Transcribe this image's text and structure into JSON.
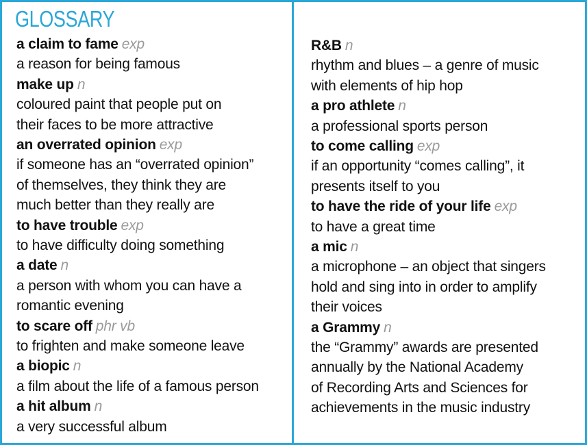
{
  "title": "GLOSSARY",
  "left_entries": [
    {
      "term": "a claim to fame",
      "pos": "exp",
      "definition": [
        "a reason for being famous"
      ]
    },
    {
      "term": "make up",
      "pos": "n",
      "definition": [
        "coloured paint that people put on",
        "their faces to be more attractive"
      ]
    },
    {
      "term": "an overrated opinion",
      "pos": "exp",
      "definition": [
        "if someone has an “overrated opinion”",
        "of themselves, they think they are",
        "much better than they really are"
      ]
    },
    {
      "term": "to have trouble",
      "pos": "exp",
      "definition": [
        "to have difficulty doing something"
      ]
    },
    {
      "term": "a date",
      "pos": "n",
      "definition": [
        "a person with whom you can have a",
        "romantic evening"
      ]
    },
    {
      "term": "to scare off",
      "pos": "phr vb",
      "definition": [
        "to frighten and make someone leave"
      ]
    },
    {
      "term": "a biopic",
      "pos": "n",
      "definition": [
        "a film about the life of a famous person"
      ]
    },
    {
      "term": "a hit album",
      "pos": "n",
      "definition": [
        "a very successful album"
      ]
    }
  ],
  "right_entries": [
    {
      "term": "R&B",
      "pos": "n",
      "definition": [
        "rhythm and blues – a genre of music",
        "with elements of hip hop"
      ]
    },
    {
      "term": "a pro athlete",
      "pos": "n",
      "definition": [
        "a professional sports person"
      ]
    },
    {
      "term": "to come calling",
      "pos": "exp",
      "definition": [
        "if an opportunity “comes calling”, it",
        "presents itself to you"
      ]
    },
    {
      "term": "to have the ride of your life",
      "pos": "exp",
      "definition": [
        "to have a great time"
      ]
    },
    {
      "term": "a mic",
      "pos": "n",
      "definition": [
        "a microphone – an object that singers",
        "hold and sing into in order to amplify",
        "their voices"
      ]
    },
    {
      "term": "a Grammy",
      "pos": "n",
      "definition": [
        "the “Grammy” awards are presented",
        "annually by the National Academy",
        "of Recording Arts and Sciences for",
        "achievements in the music industry"
      ]
    }
  ]
}
